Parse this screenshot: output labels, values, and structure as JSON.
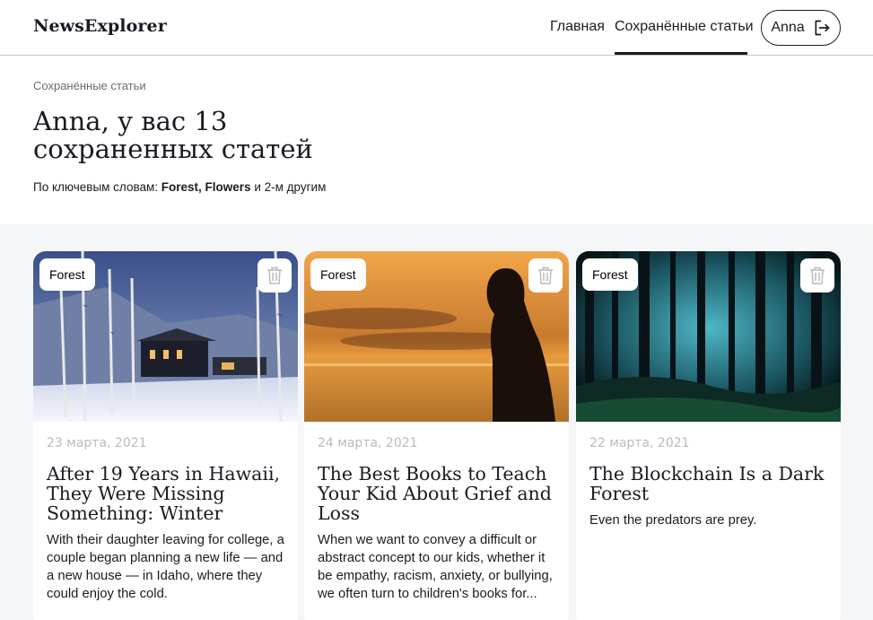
{
  "header": {
    "logo": "NewsExplorer",
    "nav_home": "Главная",
    "nav_saved": "Сохранённые статьи",
    "user_name": "Anna",
    "logout_icon": "logout-icon"
  },
  "intro": {
    "breadcrumb": "Сохранённые статьи",
    "title_line1": "Anna, у вас 13",
    "title_line2": "сохраненных статей",
    "keywords_prefix": "По ключевым словам: ",
    "keywords_bold": "Forest, Flowers",
    "keywords_suffix": " и 2-м другим"
  },
  "cards": [
    {
      "tag": "Forest",
      "date": "23 марта, 2021",
      "title": "After 19 Years in Hawaii, They Were Missing Something: Winter",
      "text": "With their daughter leaving for college, a couple began planning a new life — and a new house — in Idaho, where they could enjoy the cold.",
      "image": "snowy-house-forest"
    },
    {
      "tag": "Forest",
      "date": "24 марта, 2021",
      "title": "The Best Books to Teach Your Kid About Grief and Loss",
      "text": "When we want to convey a difficult or abstract concept to our kids, whether it be empathy, racism, anxiety, or bullying, we often turn to children's books for...",
      "image": "girl-sunset-silhouette"
    },
    {
      "tag": "Forest",
      "date": "22 марта, 2021",
      "title": "The Blockchain Is a Dark Forest",
      "text": "Even the predators are prey.",
      "image": "dark-forest"
    }
  ],
  "colors": {
    "text": "#1a1b22",
    "muted": "#b6bcbf",
    "background_gray": "#f5f6f7"
  }
}
